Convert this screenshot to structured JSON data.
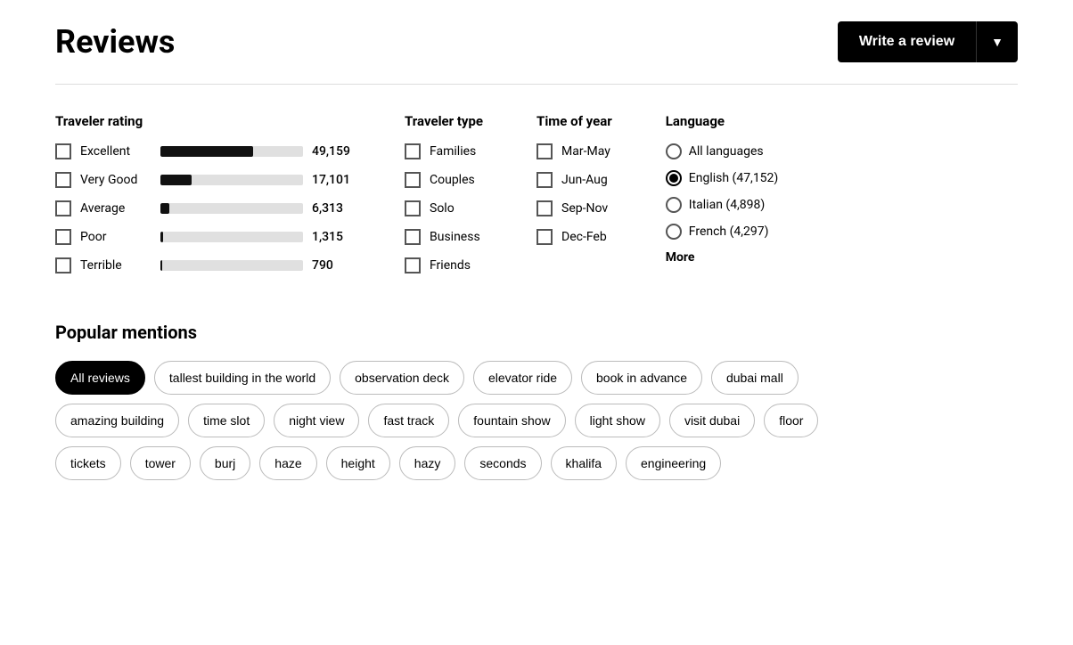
{
  "header": {
    "title": "Reviews",
    "write_review_label": "Write a review",
    "dropdown_arrow": "▼"
  },
  "traveler_rating": {
    "title": "Traveler rating",
    "items": [
      {
        "label": "Excellent",
        "count": "49,159",
        "bar_pct": 65
      },
      {
        "label": "Very Good",
        "count": "17,101",
        "bar_pct": 22
      },
      {
        "label": "Average",
        "count": "6,313",
        "bar_pct": 6
      },
      {
        "label": "Poor",
        "count": "1,315",
        "bar_pct": 2
      },
      {
        "label": "Terrible",
        "count": "790",
        "bar_pct": 1
      }
    ]
  },
  "traveler_type": {
    "title": "Traveler type",
    "items": [
      "Families",
      "Couples",
      "Solo",
      "Business",
      "Friends"
    ]
  },
  "time_of_year": {
    "title": "Time of year",
    "items": [
      "Mar-May",
      "Jun-Aug",
      "Sep-Nov",
      "Dec-Feb"
    ]
  },
  "language": {
    "title": "Language",
    "items": [
      {
        "label": "All languages",
        "count": "",
        "selected": false
      },
      {
        "label": "English (47,152)",
        "count": "",
        "selected": true
      },
      {
        "label": "Italian (4,898)",
        "count": "",
        "selected": false
      },
      {
        "label": "French (4,297)",
        "count": "",
        "selected": false
      }
    ],
    "more_label": "More"
  },
  "popular_mentions": {
    "title": "Popular mentions",
    "rows": [
      [
        {
          "label": "All reviews",
          "active": true
        },
        {
          "label": "tallest building in the world",
          "active": false
        },
        {
          "label": "observation deck",
          "active": false
        },
        {
          "label": "elevator ride",
          "active": false
        },
        {
          "label": "book in advance",
          "active": false
        },
        {
          "label": "dubai mall",
          "active": false
        }
      ],
      [
        {
          "label": "amazing building",
          "active": false
        },
        {
          "label": "time slot",
          "active": false
        },
        {
          "label": "night view",
          "active": false
        },
        {
          "label": "fast track",
          "active": false
        },
        {
          "label": "fountain show",
          "active": false
        },
        {
          "label": "light show",
          "active": false
        },
        {
          "label": "visit dubai",
          "active": false
        },
        {
          "label": "floor",
          "active": false
        }
      ],
      [
        {
          "label": "tickets",
          "active": false
        },
        {
          "label": "tower",
          "active": false
        },
        {
          "label": "burj",
          "active": false
        },
        {
          "label": "haze",
          "active": false
        },
        {
          "label": "height",
          "active": false
        },
        {
          "label": "hazy",
          "active": false
        },
        {
          "label": "seconds",
          "active": false
        },
        {
          "label": "khalifa",
          "active": false
        },
        {
          "label": "engineering",
          "active": false
        }
      ]
    ]
  }
}
